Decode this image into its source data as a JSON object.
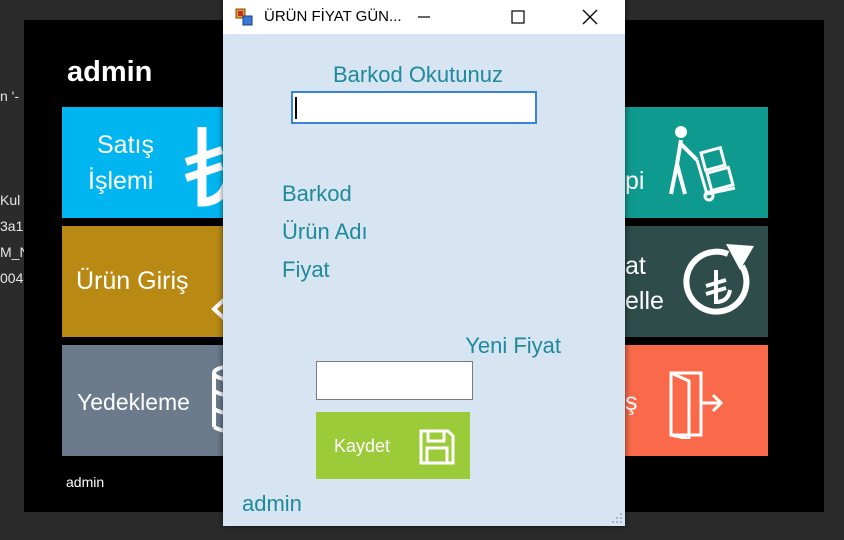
{
  "background": {
    "left_text_lines": [
      "n '-",
      "Kul",
      "3a1",
      "M_N",
      "004"
    ]
  },
  "main_form": {
    "title": "admin",
    "footer_user": "admin",
    "tiles": {
      "sales": {
        "label_line1": "Satış",
        "label_line2": "İşlemi",
        "color": "#00b5f0",
        "icon": "lira-icon"
      },
      "product_entry": {
        "label": "Ürün Giriş",
        "color": "#b88a14",
        "icon": "arrow-icon"
      },
      "backup": {
        "label": "Yedekleme",
        "color": "#6b7b8c",
        "icon": "database-icon"
      },
      "delivery": {
        "label_line2": "pi",
        "color": "#0f9a90",
        "icon": "hand-truck-icon"
      },
      "update": {
        "label_line1": "at",
        "label_line2": "elle",
        "color": "#2d4c4a",
        "icon": "refresh-lira-icon"
      },
      "exit": {
        "label": "ş",
        "color": "#fa6a4a",
        "icon": "exit-door-icon"
      }
    }
  },
  "dialog": {
    "title": "ÜRÜN FİYAT GÜN...",
    "barcode_prompt": "Barkod Okutunuz",
    "barcode_value": "",
    "barkod_label": "Barkod",
    "product_name_label": "Ürün Adı",
    "price_label": "Fiyat",
    "new_price_label": "Yeni Fiyat",
    "new_price_value": "",
    "save_label": "Kaydet",
    "user": "admin",
    "colors": {
      "label": "#1e8a9a",
      "background": "#d7e4f2",
      "save": "#9ccb3a"
    }
  }
}
